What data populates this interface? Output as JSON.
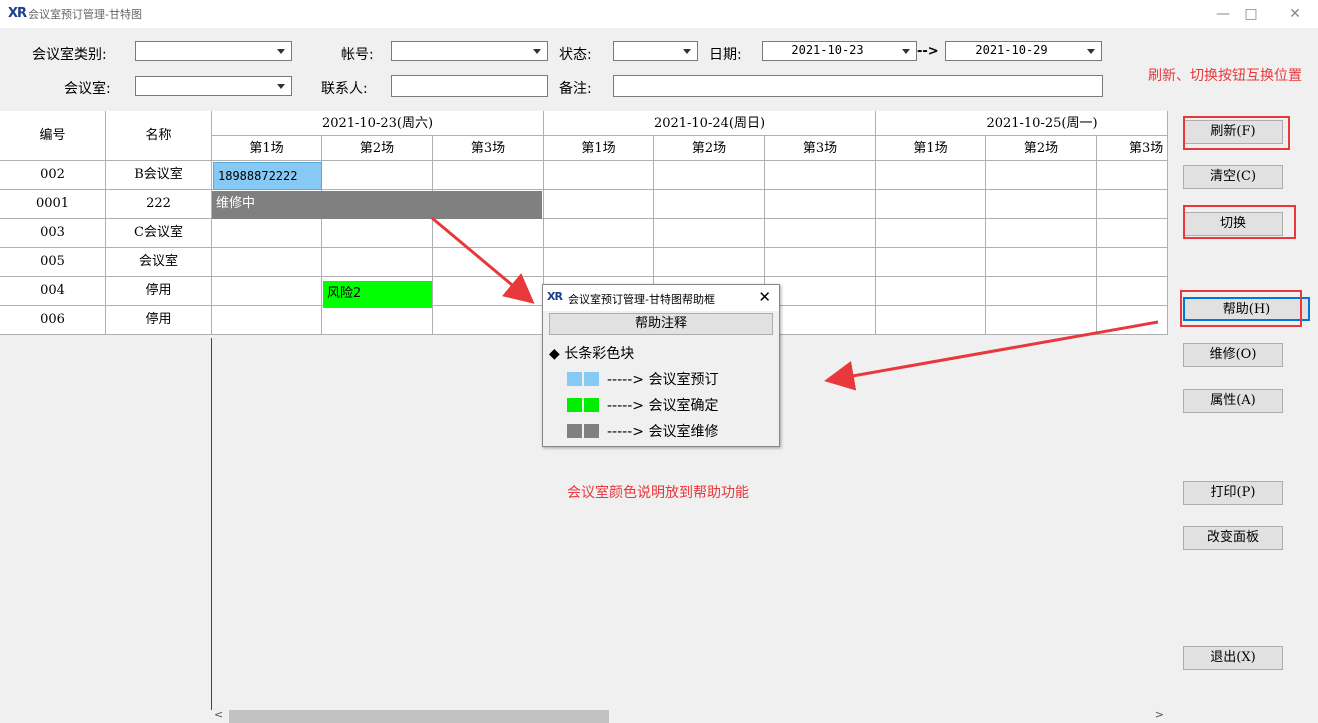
{
  "window": {
    "title": "会议室预订管理-甘特图",
    "logo": "XR"
  },
  "filters": {
    "room_type_label": "会议室类别:",
    "account_label": "帐号:",
    "status_label": "状态:",
    "date_label": "日期:",
    "date_from": "2021-10-23",
    "date_arrow": "-->",
    "date_to": "2021-10-29",
    "room_label": "会议室:",
    "contact_label": "联系人:",
    "note_label": "备注:"
  },
  "annotations": {
    "top_right": "刷新、切换按钮互换位置",
    "center": "会议室颜色说明放到帮助功能"
  },
  "grid": {
    "col_id": "编号",
    "col_name": "名称",
    "dates": [
      "2021-10-23(周六)",
      "2021-10-24(周日)",
      "2021-10-25(周一)"
    ],
    "sessions": [
      "第1场",
      "第2场",
      "第3场"
    ],
    "rows": [
      {
        "id": "002",
        "name": "B会议室"
      },
      {
        "id": "0001",
        "name": "222"
      },
      {
        "id": "003",
        "name": "C会议室"
      },
      {
        "id": "005",
        "name": "会议室"
      },
      {
        "id": "004",
        "name": "停用"
      },
      {
        "id": "006",
        "name": "停用"
      }
    ],
    "bars": {
      "booked": "18988872222",
      "repair": "维修中",
      "confirmed": "风险2"
    }
  },
  "buttons": {
    "refresh": "刷新(F)",
    "clear": "清空(C)",
    "switch": "切换",
    "help": "帮助(H)",
    "repair": "维修(O)",
    "property": "属性(A)",
    "print": "打印(P)",
    "panel": "改变面板",
    "exit": "退出(X)"
  },
  "help_dialog": {
    "title": "会议室预订管理-甘特图帮助框",
    "header_button": "帮助注释",
    "section": "◆ 长条彩色块",
    "legend": [
      {
        "text": "-----> 会议室预订",
        "color": "#86c9f4"
      },
      {
        "text": "-----> 会议室确定",
        "color": "#00ee00"
      },
      {
        "text": "-----> 会议室维修",
        "color": "#808080"
      }
    ]
  },
  "colors": {
    "booked": "#86c9f4",
    "confirmed": "#00ff00",
    "repair": "#808080",
    "annotation": "#e8383c"
  }
}
